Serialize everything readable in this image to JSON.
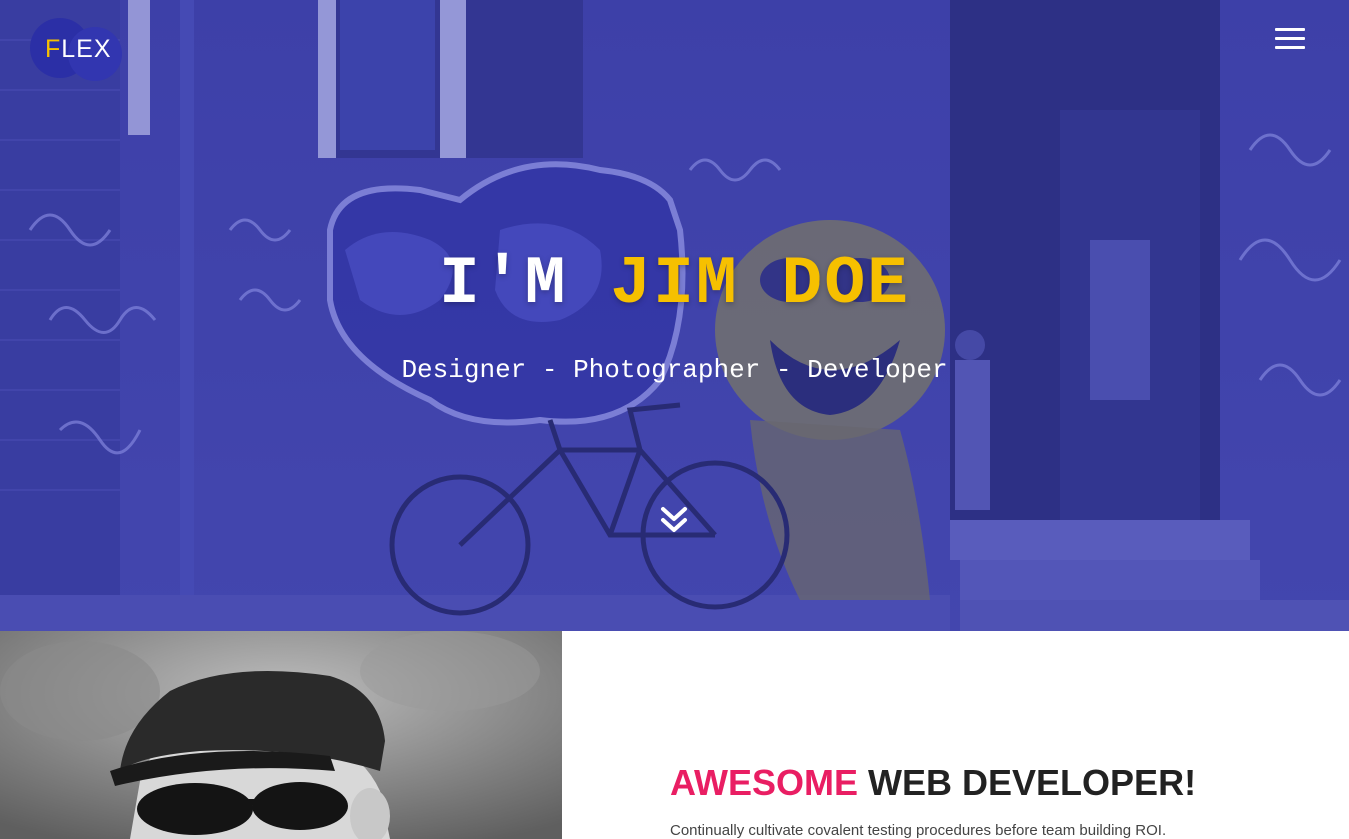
{
  "brand": {
    "first_letter": "F",
    "rest": "LEX",
    "accent_color": "#f6c000",
    "badge_color": "#2b2fa6"
  },
  "nav": {
    "menu_icon": "hamburger-menu-icon"
  },
  "hero": {
    "title_prefix": "I'M",
    "title_name": "JIM DOE",
    "subtitle": "Designer - Photographer - Developer",
    "scroll_icon": "double-chevron-down-icon",
    "overlay_color": "#3f42af",
    "highlight_color": "#f6c000"
  },
  "about": {
    "heading_highlight": "AWESOME",
    "heading_rest": "WEB DEVELOPER!",
    "paragraph": "Continually cultivate covalent testing procedures before team building ROI.",
    "highlight_color": "#e91e63"
  }
}
